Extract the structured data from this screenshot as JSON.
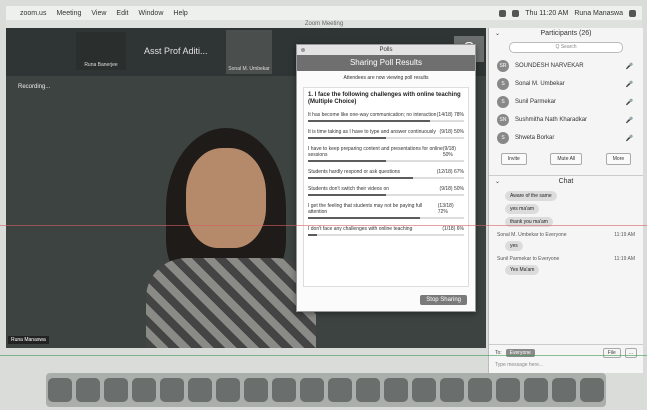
{
  "menubar": {
    "app": "zoom.us",
    "items": [
      "Meeting",
      "View",
      "Edit",
      "Window",
      "Help"
    ],
    "status_right": "Thu 11:20 AM",
    "user": "Runa Manaswa"
  },
  "window": {
    "title": "Zoom Meeting"
  },
  "video": {
    "strip_tile1_name": "Runa Banerjee",
    "strip_speaker": "Asst Prof Aditi...",
    "strip_tile3_initial": "S",
    "strip_tile3_name": "Sonal M. Umbekar",
    "recording_label": "Recording...",
    "bottom_name": "Runa Manaswa"
  },
  "poll": {
    "window_title": "Polls",
    "subtitle": "Sharing Poll Results",
    "note": "Attendees are now viewing poll results",
    "question": "1. I face the following challenges with online teaching (Multiple Choice)",
    "options": [
      {
        "text": "It has become like one-way communication; no interaction",
        "result": "(14/18) 78%",
        "pct": 78
      },
      {
        "text": "It is time taking as I have to type and answer continuously",
        "result": "(9/18) 50%",
        "pct": 50
      },
      {
        "text": "I have to keep preparing content and presentations for online sessions",
        "result": "(9/18) 50%",
        "pct": 50
      },
      {
        "text": "Students hardly respond or ask questions",
        "result": "(12/18) 67%",
        "pct": 67
      },
      {
        "text": "Students don't switch their videos on",
        "result": "(9/18) 50%",
        "pct": 50
      },
      {
        "text": "I get the feeling that students may not be paying full attention",
        "result": "(13/18) 72%",
        "pct": 72
      },
      {
        "text": "I don't face any challenges with online teaching",
        "result": "(1/18) 6%",
        "pct": 6
      }
    ],
    "stop_label": "Stop Sharing"
  },
  "participants": {
    "title": "Participants (26)",
    "search_placeholder": "Q Search",
    "list": [
      {
        "initials": "SR",
        "name": "SOUNDESH NARVEKAR"
      },
      {
        "initials": "S",
        "name": "Sonal M. Umbekar"
      },
      {
        "initials": "S",
        "name": "Sunil Parmekar"
      },
      {
        "initials": "SN",
        "name": "Sushmitha Nath Kharadkar"
      },
      {
        "initials": "S",
        "name": "Shweta Borkar"
      }
    ],
    "buttons": {
      "invite": "Invite",
      "mute_all": "Mute All",
      "more": "More"
    }
  },
  "chat": {
    "title": "Chat",
    "messages": [
      {
        "type": "bubble",
        "text": "Aware of the same"
      },
      {
        "type": "bubble",
        "text": "yes ma'am"
      },
      {
        "type": "bubble",
        "text": "thank you ma'am"
      },
      {
        "type": "sender",
        "from": "Sonal M. Umbekar to Everyone",
        "time": "11:19 AM",
        "text": "yes"
      },
      {
        "type": "sender",
        "from": "Sunil Parmekar to Everyone",
        "time": "11:19 AM",
        "text": "Yes Ma'am"
      }
    ],
    "to_label": "To:",
    "to_value": "Everyone",
    "file_label": "File",
    "more_label": "...",
    "placeholder": "Type message here..."
  },
  "dock": {
    "count": 20
  }
}
